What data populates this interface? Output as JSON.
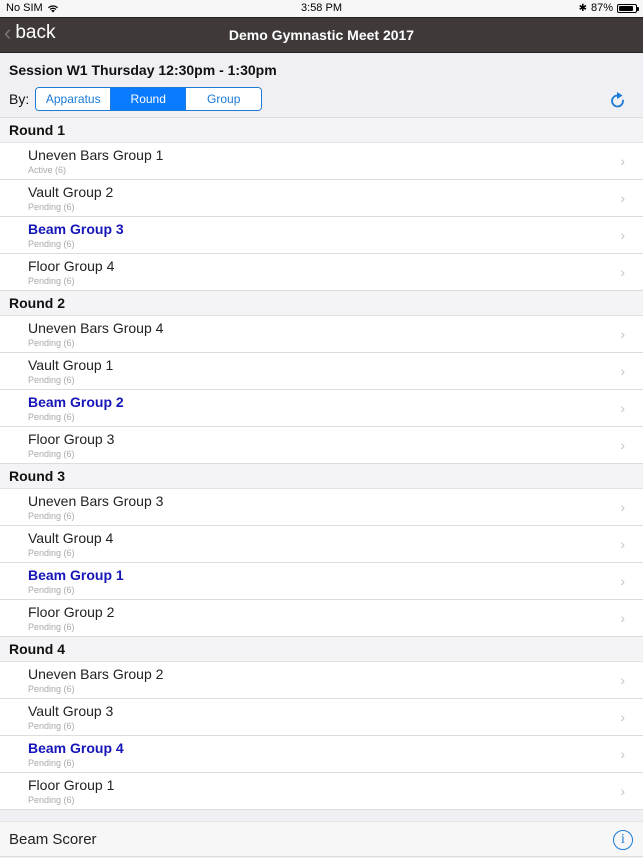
{
  "status_bar": {
    "carrier": "No SIM",
    "time": "3:58 PM",
    "battery": "87%",
    "battery_level": 0.87
  },
  "navbar": {
    "back_label": "back",
    "title": "Demo Gymnastic Meet 2017"
  },
  "session": {
    "title": "Session W1 Thursday 12:30pm - 1:30pm"
  },
  "filter": {
    "label": "By:",
    "options": [
      "Apparatus",
      "Round",
      "Group"
    ],
    "selected": "Round"
  },
  "rounds": [
    {
      "title": "Round 1",
      "items": [
        {
          "name": "Uneven Bars Group 1",
          "status": "Active (6)",
          "beam": false
        },
        {
          "name": "Vault Group 2",
          "status": "Pending (6)",
          "beam": false
        },
        {
          "name": "Beam Group 3",
          "status": "Pending (6)",
          "beam": true
        },
        {
          "name": "Floor Group 4",
          "status": "Pending (6)",
          "beam": false
        }
      ]
    },
    {
      "title": "Round 2",
      "items": [
        {
          "name": "Uneven Bars Group 4",
          "status": "Pending (6)",
          "beam": false
        },
        {
          "name": "Vault Group 1",
          "status": "Pending (6)",
          "beam": false
        },
        {
          "name": "Beam Group 2",
          "status": "Pending (6)",
          "beam": true
        },
        {
          "name": "Floor Group 3",
          "status": "Pending (6)",
          "beam": false
        }
      ]
    },
    {
      "title": "Round 3",
      "items": [
        {
          "name": "Uneven Bars Group 3",
          "status": "Pending (6)",
          "beam": false
        },
        {
          "name": "Vault Group 4",
          "status": "Pending (6)",
          "beam": false
        },
        {
          "name": "Beam Group 1",
          "status": "Pending (6)",
          "beam": true
        },
        {
          "name": "Floor Group 2",
          "status": "Pending (6)",
          "beam": false
        }
      ]
    },
    {
      "title": "Round 4",
      "items": [
        {
          "name": "Uneven Bars Group 2",
          "status": "Pending (6)",
          "beam": false
        },
        {
          "name": "Vault Group 3",
          "status": "Pending (6)",
          "beam": false
        },
        {
          "name": "Beam Group 4",
          "status": "Pending (6)",
          "beam": true
        },
        {
          "name": "Floor Group 1",
          "status": "Pending (6)",
          "beam": false
        }
      ]
    }
  ],
  "footer": {
    "label": "Beam Scorer",
    "info_icon": "i"
  },
  "colors": {
    "accent": "#1a7bd8",
    "beam_text": "#1515b8",
    "navbar_bg": "#3f3a39"
  }
}
